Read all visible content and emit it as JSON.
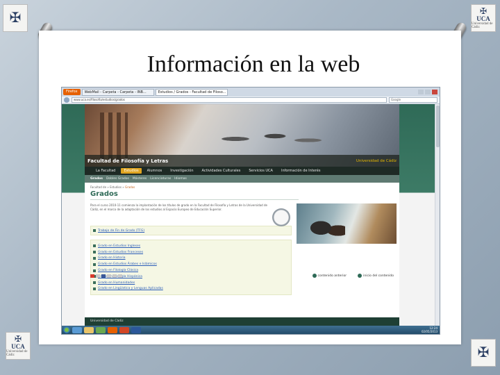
{
  "slide": {
    "title": "Información en la web"
  },
  "logos": {
    "name": "UCA",
    "sub": "Universidad de Cádiz"
  },
  "browser": {
    "firefox_label": "Firefox",
    "tabs": [
      "WebMail - Carpeta - Carpeta - INB...",
      "Estudios / Grados - Facultad de Filoso..."
    ],
    "url": "www.uca.es/filosofia/estudios/grados",
    "search_placeholder": "Google"
  },
  "site": {
    "faculty_name": "Facultad de Filosofía y Letras",
    "university_name": "Universidad de Cádiz",
    "menu": [
      "La Facultad",
      "Estudios",
      "Alumnos",
      "Investigación",
      "Actividades Culturales",
      "Servicios UCA",
      "Información de Interés"
    ],
    "menu_active": 1,
    "submenu": [
      "Grados",
      "Dobles Grados",
      "Másteres",
      "Licenciaturas",
      "Idiomas"
    ],
    "submenu_active": 0,
    "breadcrumb": [
      "Facultad de",
      "Estudios",
      "Grados"
    ],
    "page_title": "Grados",
    "intro": "Para el curso 2010-11 comienza la implantación de los títulos de grado en la Facultad de Filosofía y Letras de la Universidad de Cádiz, en el marco de la adaptación de los estudios al Espacio Europeo de Educación Superior.",
    "tfg_link": "Trabajo de Fin de Grado (TFG)",
    "grados": [
      "Grado en Estudios Ingleses",
      "Grado en Estudios Franceses",
      "Grado en Historia",
      "Grado en Estudios Árabes e Islámicos",
      "Grado en Filología Clásica",
      "Grado en Filología Hispánica",
      "Grado en Humanidades",
      "Grado en Lingüística y Lenguas Aplicadas"
    ],
    "pager_prev": "contenido anterior",
    "pager_next": "inicio del contenido",
    "footer": "Universidad de Cádiz"
  },
  "taskbar": {
    "time": "12:24",
    "date": "02/05/2013"
  }
}
